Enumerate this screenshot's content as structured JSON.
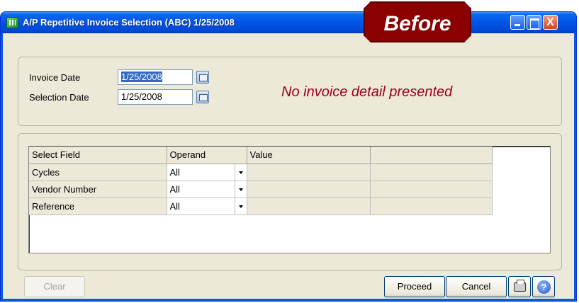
{
  "window": {
    "title": "A/P Repetitive Invoice Selection (ABC) 1/25/2008",
    "close_glyph": "X"
  },
  "badge": {
    "text": "Before"
  },
  "header": {
    "invoice_date_label": "Invoice Date",
    "invoice_date_value": "1/25/2008",
    "selection_date_label": "Selection Date",
    "selection_date_value": "1/25/2008",
    "note": "No invoice detail presented"
  },
  "grid": {
    "columns": [
      "Select Field",
      "Operand",
      "Value",
      ""
    ],
    "rows": [
      {
        "field": "Cycles",
        "operand": "All"
      },
      {
        "field": "Vendor Number",
        "operand": "All"
      },
      {
        "field": "Reference",
        "operand": "All"
      }
    ]
  },
  "footer": {
    "clear_label": "Clear",
    "proceed_label": "Proceed",
    "cancel_label": "Cancel",
    "help_glyph": "?"
  },
  "icons": {
    "app": "app-icon",
    "calendar": "calendar-icon",
    "printer": "printer-icon",
    "help": "help-icon",
    "dropdown": "chevron-down-icon"
  },
  "colors": {
    "title_bar": "#0055e5",
    "badge_bg": "#8b0000",
    "note_text": "#a0001a",
    "window_bg": "#ece9d8"
  }
}
